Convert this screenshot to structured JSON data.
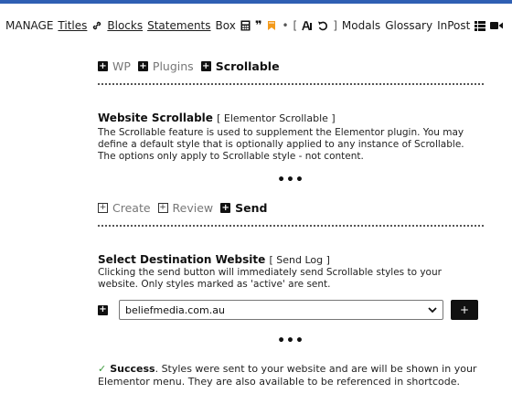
{
  "nav": {
    "manage": "MANAGE",
    "titles": "Titles",
    "blocks": "Blocks",
    "statements": "Statements",
    "box": "Box",
    "bracket_open": "[",
    "bracket_close": "]",
    "bullet": "•",
    "modals": "Modals",
    "glossary": "Glossary",
    "inpost": "InPost",
    "icons": [
      "link-icon",
      "calculator-icon",
      "quote-icon",
      "bookmark-icon",
      "font-icon",
      "undo-icon",
      "list-icon",
      "video-icon"
    ]
  },
  "top_tabs": {
    "items": [
      {
        "label": "WP",
        "active": false
      },
      {
        "label": "Plugins",
        "active": false
      },
      {
        "label": "Scrollable",
        "active": true
      }
    ]
  },
  "scrollable_section": {
    "title": "Website Scrollable",
    "subtitle": "[ Elementor Scrollable ]",
    "description": "The Scrollable feature is used to supplement the Elementor plugin. You may define a default style that is optionally applied to any instance of Scrollable. The options only apply to Scrollable style - not content."
  },
  "ellipsis": "•••",
  "action_tabs": {
    "items": [
      {
        "label": "Create",
        "active": false
      },
      {
        "label": "Review",
        "active": false
      },
      {
        "label": "Send",
        "active": true
      }
    ]
  },
  "destination": {
    "title": "Select Destination Website",
    "subtitle": "[ Send Log ]",
    "description": "Clicking the send button will immediately send Scrollable styles to your website. Only styles marked as 'active' are sent.",
    "selected_website": "beliefmedia.com.au",
    "add_button_label": "+"
  },
  "success": {
    "check": "✓",
    "label": "Success",
    "message": ". Styles were sent to your website and are will be shown in your Elementor menu. They are also available to be referenced in shortcode."
  },
  "colors": {
    "accent_blue": "#2f5fb3",
    "success_green": "#3a9a3a"
  }
}
